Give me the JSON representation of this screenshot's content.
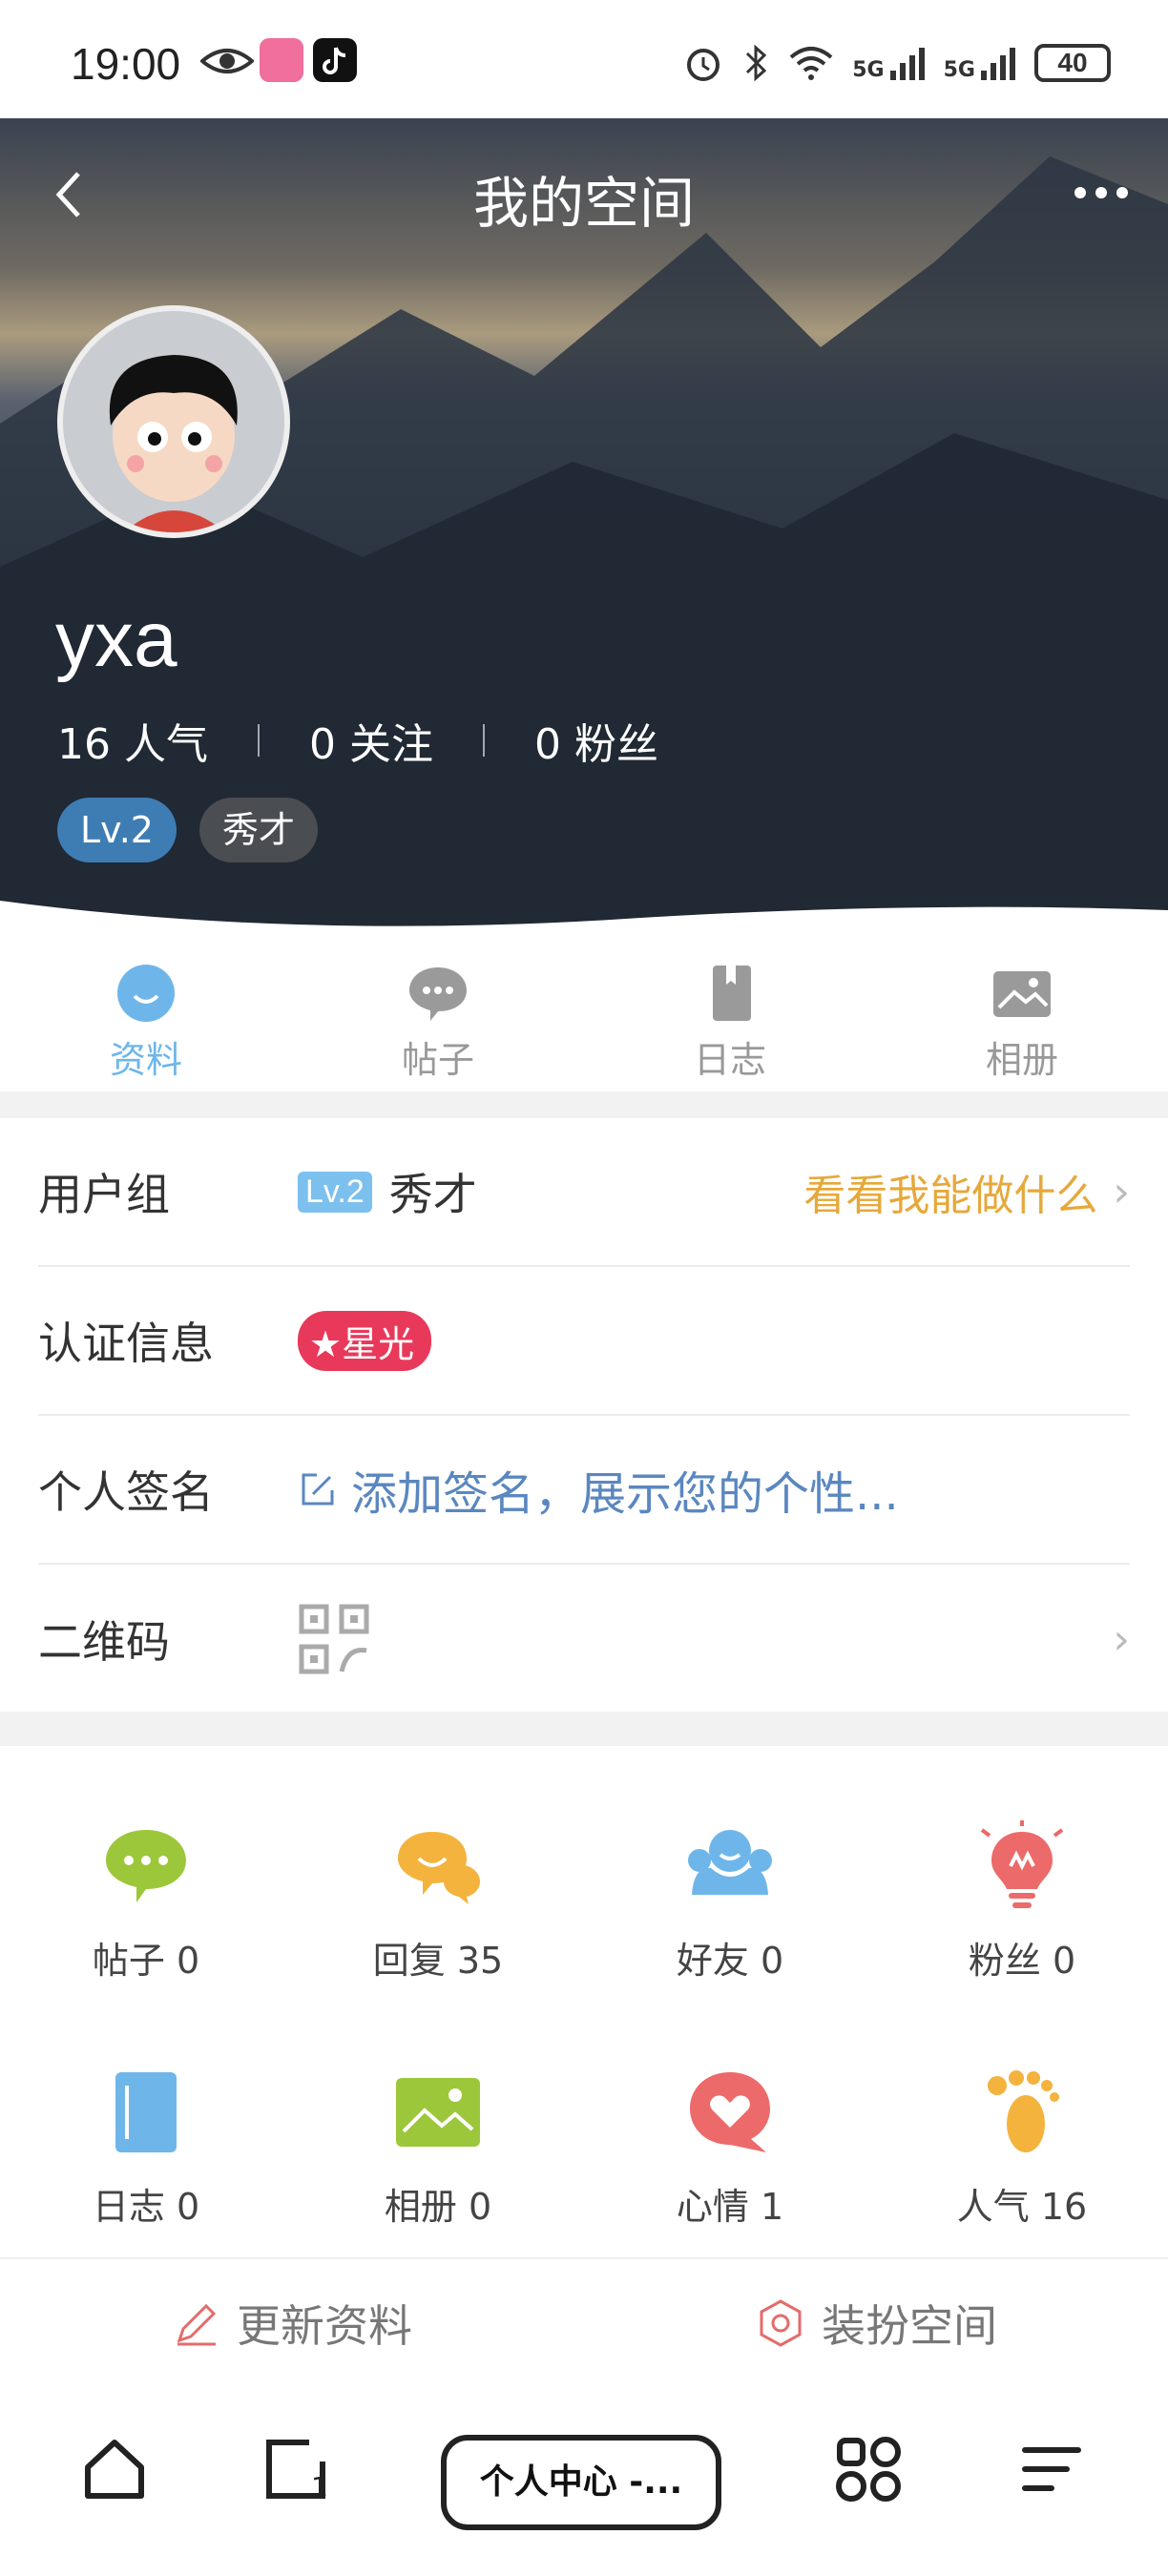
{
  "status_bar": {
    "time": "19:00",
    "battery": "40",
    "network_1": "5G",
    "network_2": "5G"
  },
  "header": {
    "title": "我的空间"
  },
  "profile": {
    "username": "yxa",
    "stats": [
      {
        "value": "16",
        "label": "人气"
      },
      {
        "value": "0",
        "label": "关注"
      },
      {
        "value": "0",
        "label": "粉丝"
      }
    ],
    "level": "Lv.2",
    "rank": "秀才"
  },
  "tabs": [
    {
      "label": "资料",
      "active": true
    },
    {
      "label": "帖子"
    },
    {
      "label": "日志"
    },
    {
      "label": "相册"
    }
  ],
  "info": {
    "user_group": {
      "label": "用户组",
      "level": "Lv.2",
      "value": "秀才",
      "link": "看看我能做什么"
    },
    "auth": {
      "label": "认证信息",
      "badge": "★星光"
    },
    "signature": {
      "label": "个人签名",
      "placeholder": "添加签名，展示您的个性..."
    },
    "qrcode": {
      "label": "二维码"
    }
  },
  "grid": [
    {
      "label": "帖子 0",
      "icon": "chat-bubble-icon",
      "color": "#9cc73a"
    },
    {
      "label": "回复 35",
      "icon": "reply-bubbles-icon",
      "color": "#f3b33d"
    },
    {
      "label": "好友 0",
      "icon": "friends-icon",
      "color": "#6eb6ea"
    },
    {
      "label": "粉丝 0",
      "icon": "lightbulb-icon",
      "color": "#ec6a6a"
    },
    {
      "label": "日志 0",
      "icon": "notebook-icon",
      "color": "#6eb6ea"
    },
    {
      "label": "相册 0",
      "icon": "photo-icon",
      "color": "#9cc73a"
    },
    {
      "label": "心情 1",
      "icon": "heart-bubble-icon",
      "color": "#ec6a6a"
    },
    {
      "label": "人气 16",
      "icon": "footprint-icon",
      "color": "#f3b33d"
    }
  ],
  "actions": {
    "update": "更新资料",
    "decorate": "装扮空间"
  },
  "browser": {
    "tab_label": "个人中心 -..."
  },
  "colors": {
    "accent_blue": "#6eb6ea",
    "link_orange": "#e6a83a",
    "badge_red": "#e8395a"
  }
}
